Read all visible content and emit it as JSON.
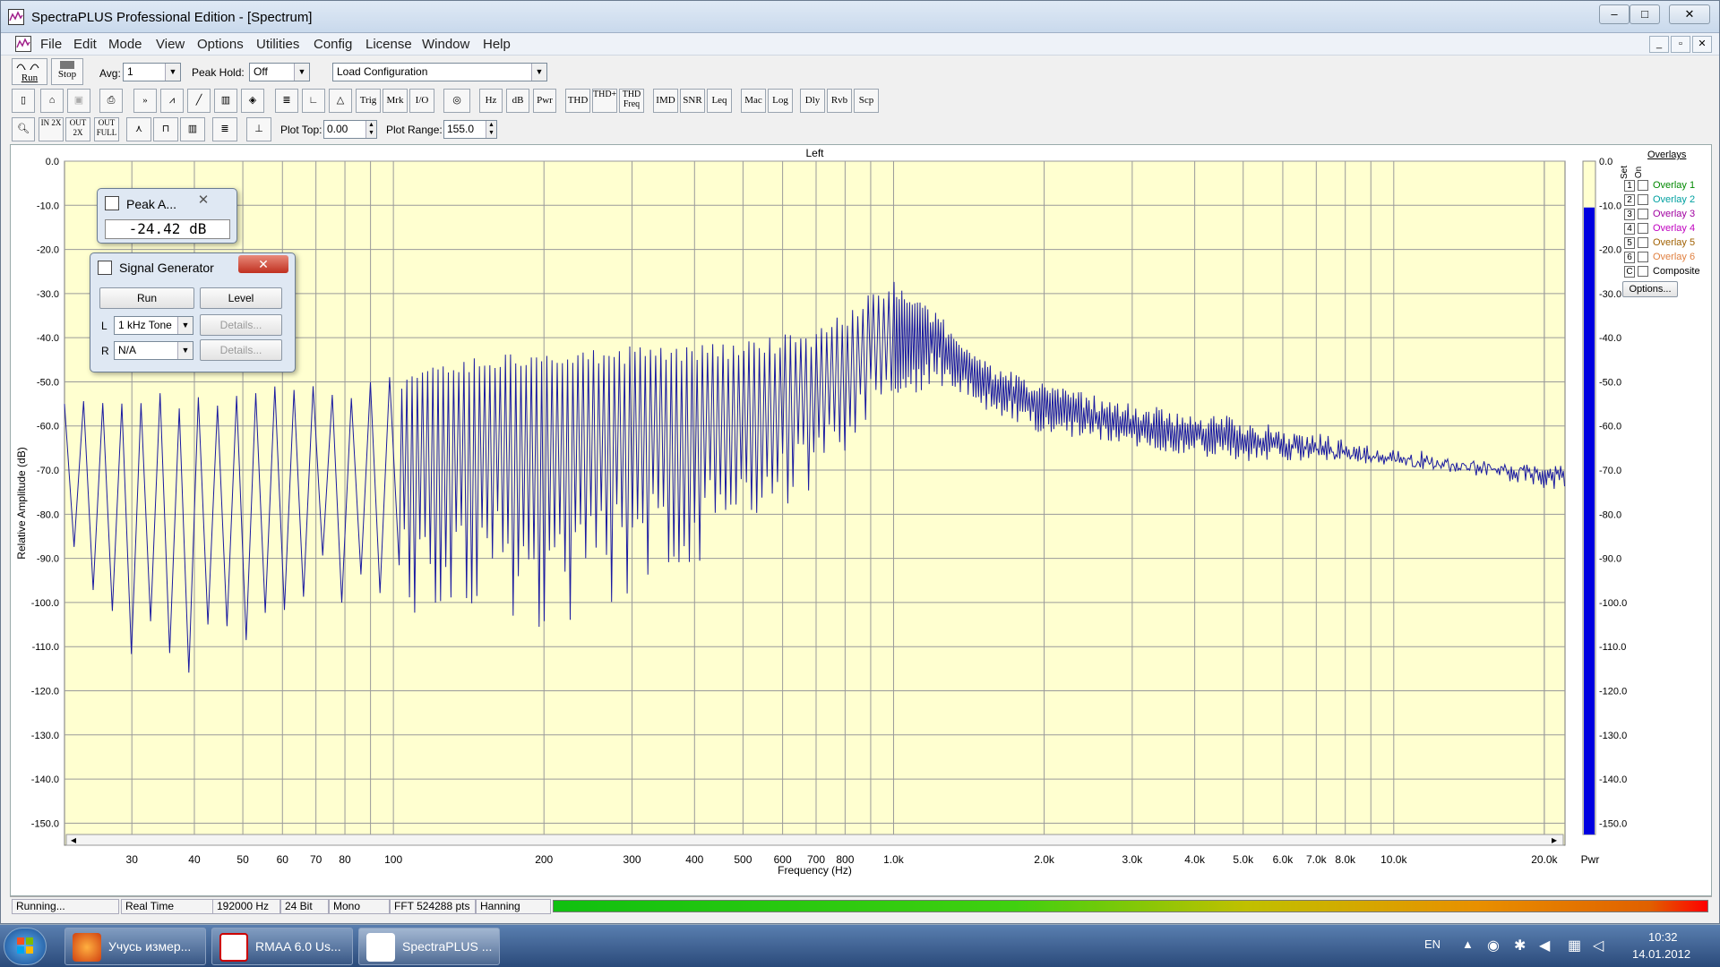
{
  "window": {
    "title": "SpectraPLUS Professional Edition - [Spectrum]",
    "controls": {
      "minimize": "–",
      "maximize": "□",
      "close": "✕"
    }
  },
  "menu": [
    "File",
    "Edit",
    "Mode",
    "View",
    "Options",
    "Utilities",
    "Config",
    "License",
    "Window",
    "Help"
  ],
  "mdi_controls": {
    "minimize": "_",
    "restore": "▫",
    "close": "✕"
  },
  "toolbar1": {
    "run_label": "Run",
    "stop_label": "Stop",
    "avg_label": "Avg:",
    "avg_value": "1",
    "peakhold_label": "Peak Hold:",
    "peakhold_value": "Off",
    "config_value": "Load Configuration"
  },
  "toolbar2": [
    "Trig",
    "Mrk",
    "I/O",
    "Hz",
    "dB",
    "Pwr",
    "THD",
    "THD+N",
    "THD Freq",
    "IMD",
    "SNR",
    "Leq",
    "Mac",
    "Log",
    "Dly",
    "Rvb",
    "Scp"
  ],
  "toolbar3": {
    "zoom_in_2x": "IN 2X",
    "zoom_out_2x": "OUT 2X",
    "zoom_out_full": "OUT FULL",
    "plot_top_label": "Plot Top:",
    "plot_top_value": "0.00",
    "plot_range_label": "Plot Range:",
    "plot_range_value": "155.0"
  },
  "chart_data": {
    "type": "line",
    "title": "Left",
    "xlabel": "Frequency (Hz)",
    "ylabel": "Relative Amplitude (dB)",
    "xscale": "log",
    "xlim": [
      22,
      22000
    ],
    "ylim": [
      -155,
      0
    ],
    "grid": true,
    "x_ticks": [
      "30",
      "40",
      "50",
      "60",
      "70",
      "80",
      "100",
      "200",
      "300",
      "400",
      "500",
      "600",
      "700",
      "800",
      "1.0k",
      "2.0k",
      "3.0k",
      "4.0k",
      "5.0k",
      "6.0k",
      "7.0k",
      "8.0k",
      "10.0k",
      "20.0k"
    ],
    "x_tick_values": [
      30,
      40,
      50,
      60,
      70,
      80,
      100,
      200,
      300,
      400,
      500,
      600,
      700,
      800,
      1000,
      2000,
      3000,
      4000,
      5000,
      6000,
      7000,
      8000,
      10000,
      20000
    ],
    "y_ticks": [
      "0.0",
      "-10.0",
      "-20.0",
      "-30.0",
      "-40.0",
      "-50.0",
      "-60.0",
      "-70.0",
      "-80.0",
      "-90.0",
      "-100.0",
      "-110.0",
      "-120.0",
      "-130.0",
      "-140.0",
      "-150.0"
    ],
    "y_tick_values": [
      0,
      -10,
      -20,
      -30,
      -40,
      -50,
      -60,
      -70,
      -80,
      -90,
      -100,
      -110,
      -120,
      -130,
      -140,
      -150
    ],
    "series": [
      {
        "color": "#1a1aa0",
        "envelope": {
          "x": [
            22,
            30,
            40,
            60,
            80,
            100,
            150,
            200,
            300,
            500,
            700,
            900,
            1000,
            1200,
            1500,
            2000,
            3000,
            5000,
            8000,
            12000,
            22000
          ],
          "upper": [
            -55,
            -52,
            -53,
            -48,
            -50,
            -48,
            -44,
            -42,
            -42,
            -41,
            -38,
            -30,
            -27,
            -33,
            -45,
            -50,
            -55,
            -58,
            -63,
            -66,
            -71
          ],
          "lower": [
            -105,
            -116,
            -116,
            -118,
            -115,
            -105,
            -100,
            -108,
            -100,
            -85,
            -75,
            -60,
            -58,
            -50,
            -56,
            -62,
            -65,
            -68,
            -68,
            -70,
            -71
          ]
        }
      }
    ],
    "level_meter": {
      "label": "Pwr",
      "value_db": -10.5,
      "color": "#0000e0",
      "ticks": [
        "0.0",
        "-10.0",
        "-20.0",
        "-30.0",
        "-40.0",
        "-50.0",
        "-60.0",
        "-70.0",
        "-80.0",
        "-90.0",
        "-100.0",
        "-110.0",
        "-120.0",
        "-130.0",
        "-140.0",
        "-150.0"
      ]
    }
  },
  "overlays": {
    "title": "Overlays",
    "set_label": "Set",
    "on_label": "On",
    "items": [
      {
        "num": "1",
        "label": "Overlay 1",
        "color": "#008800"
      },
      {
        "num": "2",
        "label": "Overlay 2",
        "color": "#00a0a0"
      },
      {
        "num": "3",
        "label": "Overlay 3",
        "color": "#a000a0"
      },
      {
        "num": "4",
        "label": "Overlay 4",
        "color": "#c000c0"
      },
      {
        "num": "5",
        "label": "Overlay 5",
        "color": "#a06000"
      },
      {
        "num": "6",
        "label": "Overlay 6",
        "color": "#e08040"
      }
    ],
    "composite_num": "C",
    "composite_label": "Composite",
    "options_label": "Options..."
  },
  "peak_window": {
    "title": "Peak A...",
    "value": "-24.42 dB"
  },
  "signal_generator": {
    "title": "Signal Generator",
    "run_label": "Run",
    "level_label": "Level",
    "left_label": "L",
    "left_value": "1 kHz Tone",
    "right_label": "R",
    "right_value": "N/A",
    "details_label": "Details..."
  },
  "status": {
    "state": "Running...",
    "mode": "Real Time",
    "rate": "192000 Hz",
    "bits": "24 Bit",
    "channels": "Mono",
    "fft": "FFT 524288 pts",
    "window": "Hanning"
  },
  "taskbar": {
    "tasks": [
      {
        "label": "Учусь измер...",
        "color": "#e06020"
      },
      {
        "label": "RMAA 6.0 Us...",
        "color": "#ffffff"
      },
      {
        "label": "SpectraPLUS ...",
        "color": "#ffffff"
      }
    ],
    "lang": "EN",
    "time": "10:32",
    "date": "14.01.2012"
  }
}
